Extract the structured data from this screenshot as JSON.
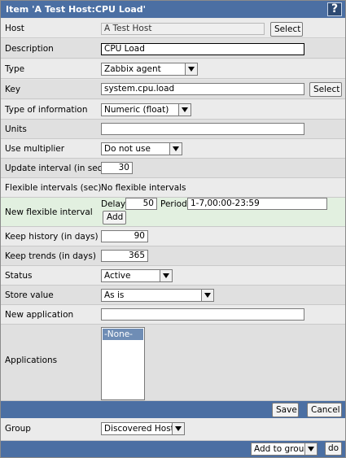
{
  "title": "Item 'A Test Host:CPU Load'",
  "help_label": "?",
  "fields": {
    "host": {
      "label": "Host",
      "value": "A Test Host",
      "button": "Select"
    },
    "description": {
      "label": "Description",
      "value": "CPU Load"
    },
    "type": {
      "label": "Type",
      "value": "Zabbix agent"
    },
    "key": {
      "label": "Key",
      "value": "system.cpu.load",
      "button": "Select"
    },
    "type_info": {
      "label": "Type of information",
      "value": "Numeric (float)"
    },
    "units": {
      "label": "Units",
      "value": ""
    },
    "multiplier": {
      "label": "Use multiplier",
      "value": "Do not use"
    },
    "update_interval": {
      "label": "Update interval (in sec)",
      "value": "30"
    },
    "flex_intervals": {
      "label": "Flexible intervals (sec)",
      "value": "No flexible intervals"
    },
    "new_flex": {
      "label": "New flexible interval",
      "delay_label": "Delay",
      "delay_value": "50",
      "period_label": "Period",
      "period_value": "1-7,00:00-23:59",
      "add_button": "Add"
    },
    "history": {
      "label": "Keep history (in days)",
      "value": "90"
    },
    "trends": {
      "label": "Keep trends (in days)",
      "value": "365"
    },
    "status": {
      "label": "Status",
      "value": "Active"
    },
    "store_value": {
      "label": "Store value",
      "value": "As is"
    },
    "new_application": {
      "label": "New application",
      "value": ""
    },
    "applications": {
      "label": "Applications",
      "options": [
        "-None-"
      ]
    }
  },
  "actions": {
    "save": "Save",
    "cancel": "Cancel"
  },
  "group": {
    "label": "Group",
    "value": "Discovered Hosts"
  },
  "bottom": {
    "action_value": "Add to group",
    "do_button": "do"
  }
}
